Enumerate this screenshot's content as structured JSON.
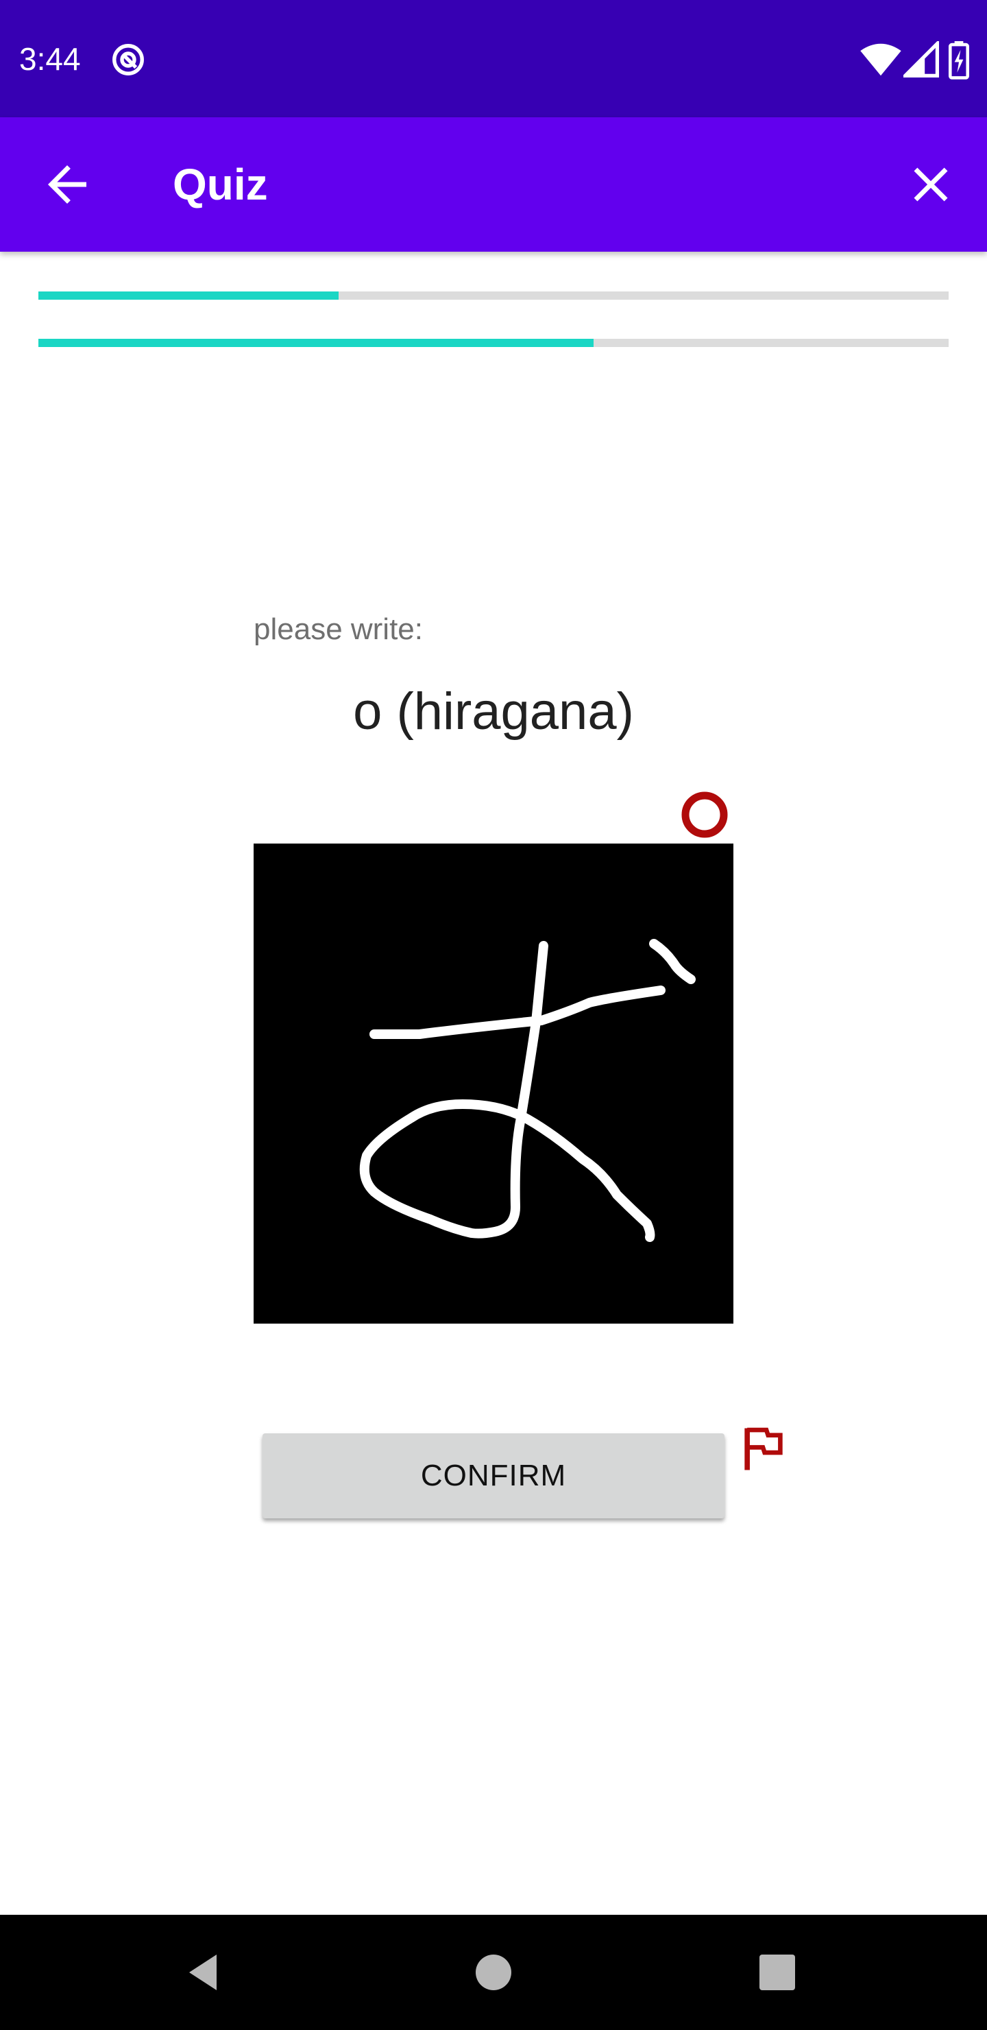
{
  "status_bar": {
    "time": "3:44",
    "icons": [
      "data-saver-icon",
      "wifi-icon",
      "cellular-signal-icon",
      "battery-charging-icon"
    ],
    "background_color": "#3700b3"
  },
  "app_bar": {
    "title": "Quiz",
    "back_icon": "arrow-back-icon",
    "close_icon": "close-icon",
    "background_color": "#6200ee"
  },
  "progress": {
    "color": "#1ad6c4",
    "track_color": "#dcdcdc",
    "bars": [
      {
        "name": "progress-bar-1",
        "value_percent": 33
      },
      {
        "name": "progress-bar-2",
        "value_percent": 61
      }
    ]
  },
  "quiz": {
    "prompt_label": "please write:",
    "target": "o (hiragana)",
    "record_indicator_color": "#b00b0b",
    "drawing_canvas_background": "#000000",
    "confirm_label": "CONFIRM",
    "flag_icon": "flag-icon",
    "flag_color": "#b00b0b"
  },
  "nav_bar": {
    "buttons": [
      "back-triangle-icon",
      "home-circle-icon",
      "recents-square-icon"
    ]
  }
}
